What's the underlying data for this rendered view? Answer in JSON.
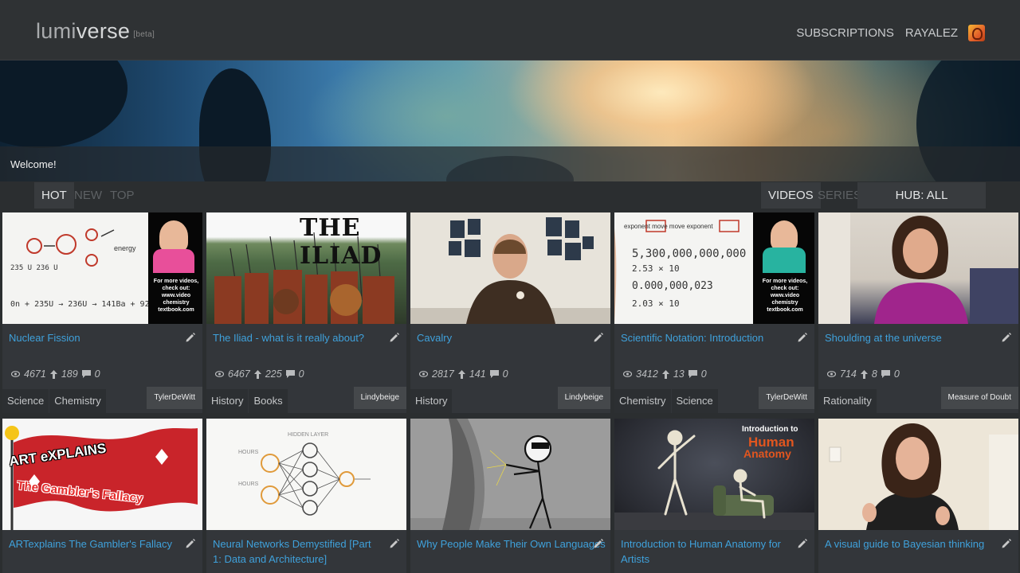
{
  "header": {
    "logo_light": "lumi",
    "logo_strong": "verse",
    "logo_badge": "[beta]",
    "nav_subscriptions": "SUBSCRIPTIONS",
    "nav_user": "RAYALEZ"
  },
  "banner": {
    "welcome": "Welcome!"
  },
  "filters": {
    "sort_tabs": [
      "HOT",
      "NEW",
      "TOP"
    ],
    "type_tabs": [
      "VIDEOS",
      "SERIES"
    ],
    "hub": "HUB: ALL"
  },
  "videos": [
    {
      "title": "Nuclear Fission",
      "views": "4671",
      "likes": "189",
      "comments": "0",
      "tags": [
        "Science",
        "Chemistry"
      ],
      "author": "TylerDeWitt"
    },
    {
      "title": "The Iliad - what is it really about?",
      "views": "6467",
      "likes": "225",
      "comments": "0",
      "tags": [
        "History",
        "Books"
      ],
      "author": "Lindybeige"
    },
    {
      "title": "Cavalry",
      "views": "2817",
      "likes": "141",
      "comments": "0",
      "tags": [
        "History"
      ],
      "author": "Lindybeige"
    },
    {
      "title": "Scientific Notation: Introduction",
      "views": "3412",
      "likes": "13",
      "comments": "0",
      "tags": [
        "Chemistry",
        "Science"
      ],
      "author": "TylerDeWitt"
    },
    {
      "title": "Shoulding at the universe",
      "views": "714",
      "likes": "8",
      "comments": "0",
      "tags": [
        "Rationality"
      ],
      "author": "Measure of Doubt"
    },
    {
      "title": "ARTexplains The Gambler's Fallacy"
    },
    {
      "title": "Neural Networks Demystified [Part 1: Data and Architecture]"
    },
    {
      "title": "Why People Make Their Own Languages"
    },
    {
      "title": "Introduction to Human Anatomy for Artists"
    },
    {
      "title": "A visual guide to Bayesian thinking"
    }
  ],
  "thumb_text": {
    "card0_lines": [
      "For more videos,",
      "check out:",
      "www.video",
      "chemistry",
      "textbook.com"
    ],
    "card1_title": "THE ILIAD",
    "card3_lines": [
      "For more videos,",
      "check out:",
      "www.video",
      "chemistry",
      "textbook.com"
    ],
    "card5_top": "ART eXPLAINS",
    "card5_bottom": "The Gambler's Fallacy",
    "card8_line1": "Introduction to",
    "card8_line2": "Human",
    "card8_line3": "Anatomy"
  },
  "colors": {
    "accent": "#3fa1db",
    "background": "#2b2e30",
    "card": "#33363a"
  }
}
